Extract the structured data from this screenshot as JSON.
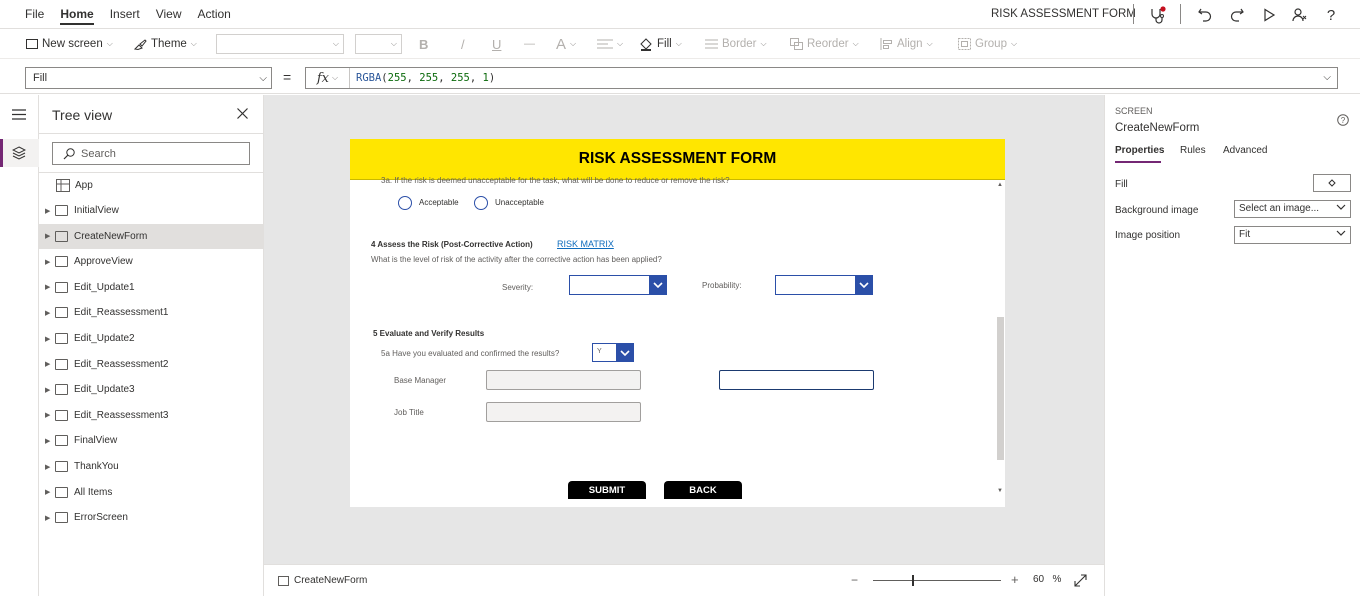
{
  "colors": {
    "banner": "#FFE600",
    "dropdown_accent": "#2B4FA8",
    "tab_accent": "#742774"
  },
  "menu": {
    "items": [
      "File",
      "Home",
      "Insert",
      "View",
      "Action"
    ],
    "active": "Home"
  },
  "app_title": "RISK ASSESSMENT FORM",
  "ribbon": {
    "new_screen": "New screen",
    "theme": "Theme",
    "bold": "B",
    "italic": "/",
    "underline": "U",
    "strike": "—",
    "font_size_icon": "A",
    "fill": "Fill",
    "border": "Border",
    "reorder": "Reorder",
    "align": "Align",
    "group": "Group"
  },
  "formula": {
    "property": "Fill",
    "equals": "=",
    "fx": "fx",
    "fn": "RGBA",
    "args": [
      "255",
      "255",
      "255",
      "1"
    ]
  },
  "tree": {
    "title": "Tree view",
    "search_placeholder": "Search",
    "app_label": "App",
    "screens": [
      "InitialView",
      "CreateNewForm",
      "ApproveView",
      "Edit_Update1",
      "Edit_Reassessment1",
      "Edit_Update2",
      "Edit_Reassessment2",
      "Edit_Update3",
      "Edit_Reassessment3",
      "FinalView",
      "ThankYou",
      "All Items",
      "ErrorScreen"
    ],
    "selected": "CreateNewForm"
  },
  "form": {
    "header": "RISK ASSESSMENT FORM",
    "cut_question": "3a. If the risk is deemed unacceptable for the task, what will be done to reduce or remove the risk?",
    "radio_acceptable": "Acceptable",
    "radio_unacceptable": "Unacceptable",
    "section4_title": "4 Assess the Risk (Post-Corrective Action)",
    "risk_matrix_link": "RISK MATRIX",
    "section4_question": "What is the level of risk of the activity after the corrective action has been applied?",
    "severity_label": "Severity:",
    "probability_label": "Probability:",
    "section5_title": "5 Evaluate and Verify Results",
    "q5a": "5a Have you evaluated and confirmed the results?",
    "q5a_value": "Y",
    "base_manager_label": "Base Manager",
    "job_title_label": "Job Title",
    "submit": "SUBMIT",
    "back": "BACK"
  },
  "status": {
    "screen_name": "CreateNewForm",
    "zoom_minus": "−",
    "zoom_plus": "+",
    "zoom": "60",
    "zoom_unit": "%"
  },
  "right_panel": {
    "kind": "SCREEN",
    "name": "CreateNewForm",
    "tabs": [
      "Properties",
      "Rules",
      "Advanced"
    ],
    "fill_label": "Fill",
    "bg_image_label": "Background image",
    "bg_image_value": "Select an image...",
    "img_pos_label": "Image position",
    "img_pos_value": "Fit"
  }
}
